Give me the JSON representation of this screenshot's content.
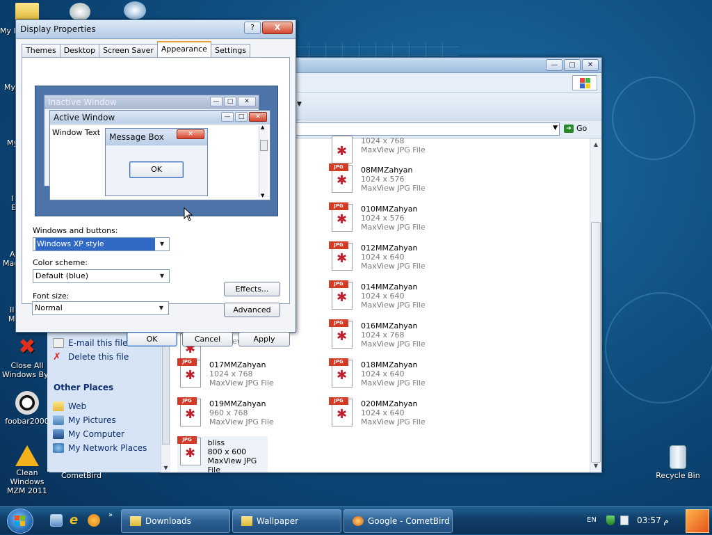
{
  "desktop": {
    "icons_partial": [
      "My I",
      "My",
      "My",
      "I",
      "E",
      "A",
      "Mag",
      "II",
      "MI"
    ],
    "icons": {
      "close_all_windows": "Close All Windows By..",
      "foobar": "foobar2000",
      "clean_windows": "Clean Windows MZM 2011",
      "cometbird": "CometBird",
      "recycle_bin": "Recycle Bin"
    }
  },
  "explorer": {
    "address_go": "Go",
    "left_panel": {
      "email_file": "E-mail this file",
      "delete_file": "Delete this file",
      "other_places_header": "Other Places",
      "places": [
        "Web",
        "My Pictures",
        "My Computer",
        "My Network Places"
      ]
    },
    "files": [
      {
        "name": "",
        "dims": "1024 x 768",
        "type": "MaxView JPG File"
      },
      {
        "name": "08MMZahyan",
        "dims": "1024 x 576",
        "type": "MaxView JPG File"
      },
      {
        "name": "010MMZahyan",
        "dims": "1024 x 576",
        "type": "MaxView JPG File"
      },
      {
        "name": "012MMZahyan",
        "dims": "1024 x 640",
        "type": "MaxView JPG File"
      },
      {
        "name": "014MMZahyan",
        "dims": "1024 x 640",
        "type": "MaxView JPG File"
      },
      {
        "name": "016MMZahyan",
        "dims": "1024 x 768",
        "type": "MaxView JPG File"
      },
      {
        "name": "",
        "dims": "",
        "type": "MaxView JPG File"
      },
      {
        "name": "017MMZahyan",
        "dims": "1024 x 768",
        "type": "MaxView JPG File"
      },
      {
        "name": "018MMZahyan",
        "dims": "1024 x 640",
        "type": "MaxView JPG File"
      },
      {
        "name": "019MMZahyan",
        "dims": "960 x 768",
        "type": "MaxView JPG File"
      },
      {
        "name": "020MMZahyan",
        "dims": "1024 x 640",
        "type": "MaxView JPG File"
      },
      {
        "name": "bliss",
        "dims": "800 x 600",
        "type": "MaxView JPG File"
      }
    ],
    "jpg_tag": "JPG"
  },
  "dialog": {
    "title": "Display Properties",
    "help": "?",
    "close": "X",
    "tabs": [
      "Themes",
      "Desktop",
      "Screen Saver",
      "Appearance",
      "Settings"
    ],
    "active_tab": "Appearance",
    "preview": {
      "inactive_window": "Inactive Window",
      "active_window": "Active Window",
      "window_text": "Window Text",
      "message_box": "Message Box",
      "ok": "OK"
    },
    "windows_buttons_label": "Windows and buttons:",
    "windows_buttons_value": "Windows XP style",
    "color_scheme_label": "Color scheme:",
    "color_scheme_value": "Default (blue)",
    "font_size_label": "Font size:",
    "font_size_value": "Normal",
    "effects_button": "Effects...",
    "advanced_button": "Advanced",
    "ok_button": "OK",
    "cancel_button": "Cancel",
    "apply_button": "Apply"
  },
  "taskbar": {
    "buttons": [
      "Downloads",
      "Wallpaper",
      "Google - CometBird"
    ],
    "lang": "EN",
    "clock": "03:57 م"
  },
  "colors": {
    "desktop_blue": "#0f4f82",
    "taskbar": "#0f3d66",
    "selection": "#3169c6",
    "jpg_red": "#d23b26"
  }
}
